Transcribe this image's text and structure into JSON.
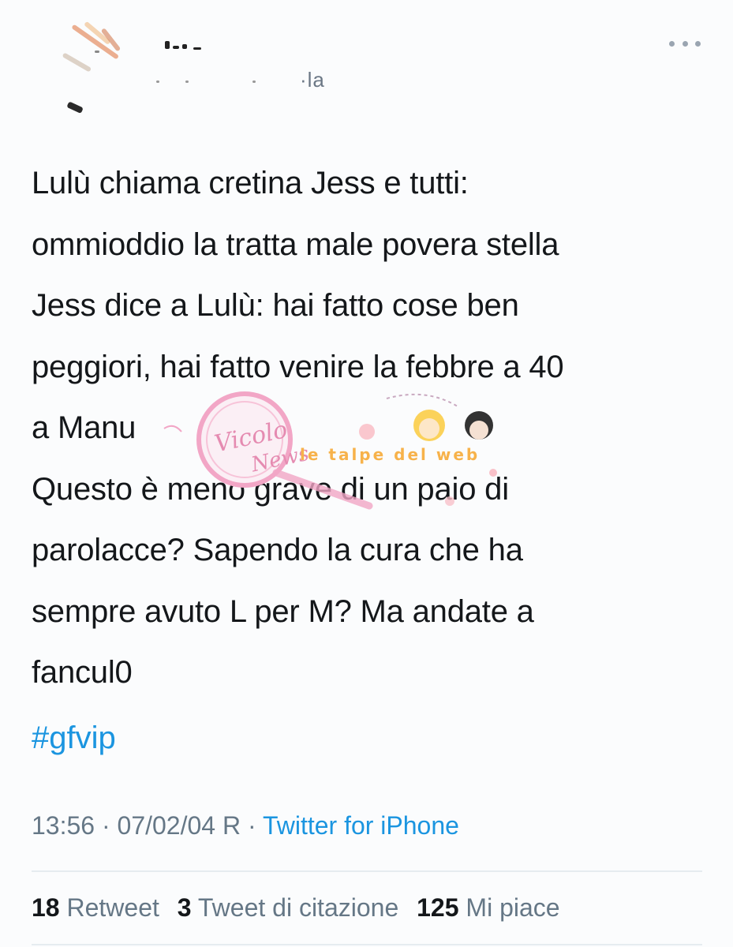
{
  "header": {
    "handle_fragment": "·la"
  },
  "tweet": {
    "lines": [
      "Lulù chiama cretina Jess e tutti:",
      "ommioddio la tratta male povera stella",
      "Jess dice a Lulù: hai fatto cose ben",
      "peggiori, hai fatto venire la febbre a 40",
      "a Manu",
      "Questo è meno grave di un paio di",
      "parolacce? Sapendo la cura che ha",
      "sempre avuto L per M? Ma andate a",
      "fancul0"
    ],
    "hashtag": "#gfvip"
  },
  "watermark": {
    "logo_text": "Vicolo delle News",
    "banner_text": "le talpe del web"
  },
  "meta": {
    "time": "13:56",
    "separator": " · ",
    "date": "07/02/04 R",
    "source": "Twitter for iPhone"
  },
  "stats": {
    "retweets": {
      "count": "18",
      "label": "Retweet"
    },
    "quotes": {
      "count": "3",
      "label": "Tweet di citazione"
    },
    "likes": {
      "count": "125",
      "label": "Mi piace"
    }
  },
  "colors": {
    "text": "#14171a",
    "link": "#1b95e0",
    "muted": "#657786",
    "watermark_pink": "#f2a6c6",
    "watermark_orange": "#f7b24a"
  }
}
